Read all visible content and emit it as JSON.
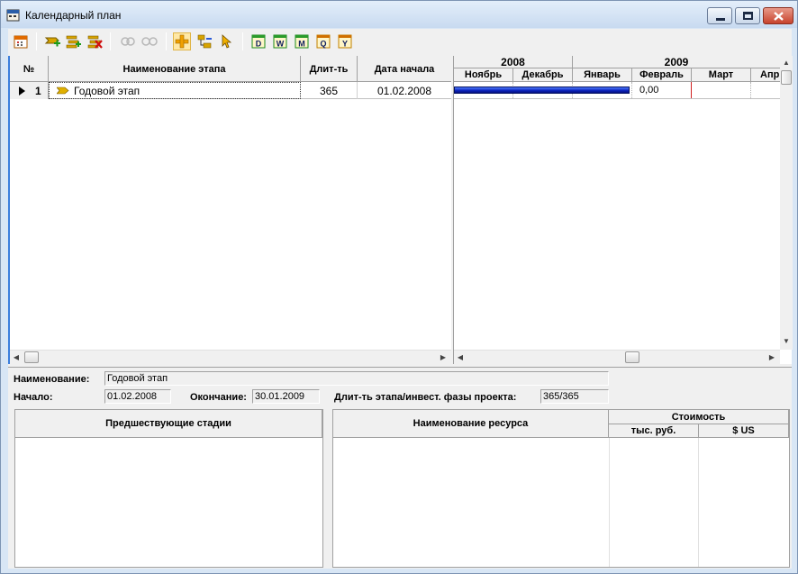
{
  "window": {
    "title": "Календарный план"
  },
  "toolbar": {
    "buttons": [
      {
        "name": "calendar-icon"
      },
      {
        "name": "add-stage-icon"
      },
      {
        "name": "add-substage-icon"
      },
      {
        "name": "delete-stage-icon"
      },
      {
        "name": "link-icon"
      },
      {
        "name": "unlink-icon"
      },
      {
        "name": "add-icon"
      },
      {
        "name": "hierarchy-icon"
      },
      {
        "name": "pointer-icon"
      },
      {
        "name": "scale-day",
        "label": "D"
      },
      {
        "name": "scale-week",
        "label": "W"
      },
      {
        "name": "scale-month",
        "label": "M"
      },
      {
        "name": "scale-quarter",
        "label": "Q"
      },
      {
        "name": "scale-year",
        "label": "Y"
      }
    ]
  },
  "grid": {
    "headers": {
      "num": "№",
      "name": "Наименование этапа",
      "duration": "Длит-ть",
      "start": "Дата начала"
    },
    "rows": [
      {
        "num": "1",
        "name": "Годовой этап",
        "duration": "365",
        "start": "01.02.2008"
      }
    ]
  },
  "gantt": {
    "years": [
      "2008",
      "2009"
    ],
    "months": [
      "Ноябрь",
      "Декабрь",
      "Январь",
      "Февраль",
      "Март",
      "Апр"
    ],
    "bar_value": "0,00",
    "bar_color": "#1535d8",
    "today_line_color": "#d02020"
  },
  "details": {
    "name_label": "Наименование:",
    "name_value": "Годовой этап",
    "start_label": "Начало:",
    "start_value": "01.02.2008",
    "end_label": "Окончание:",
    "end_value": "30.01.2009",
    "duration_label": "Длит-ть этапа/инвест. фазы проекта:",
    "duration_value": "365/365",
    "predecessors_header": "Предшествующие стадии",
    "resource_header": "Наименование ресурса",
    "cost_header": "Стоимость",
    "cost_rub": "тыс. руб.",
    "cost_usd": "$ US"
  }
}
